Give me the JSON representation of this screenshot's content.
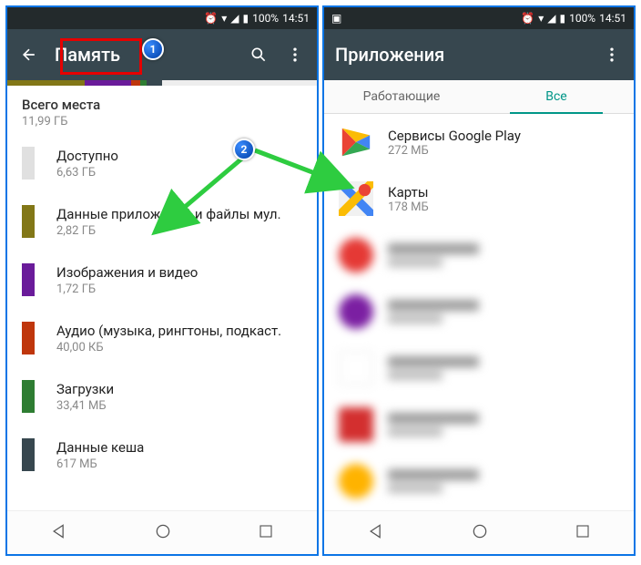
{
  "status": {
    "battery": "100%",
    "time": "14:51"
  },
  "left": {
    "title": "Память",
    "total_label": "Всего места",
    "total_value": "11,99 ГБ",
    "items": [
      {
        "label": "Доступно",
        "value": "6,63 ГБ",
        "color": "#e0e0e0"
      },
      {
        "label": "Данные приложений и файлы мул.",
        "value": "2,82 ГБ",
        "color": "#827717"
      },
      {
        "label": "Изображения и видео",
        "value": "1,72 ГБ",
        "color": "#6a1b9a"
      },
      {
        "label": "Аудио (музыка, рингтоны, подкаст.",
        "value": "40,00 КБ",
        "color": "#bf360c"
      },
      {
        "label": "Загрузки",
        "value": "33,41 МБ",
        "color": "#2e7d32"
      },
      {
        "label": "Данные кеша",
        "value": "617 МБ",
        "color": "#37474f"
      }
    ]
  },
  "right": {
    "title": "Приложения",
    "tab_running": "Работающие",
    "tab_all": "Все",
    "apps": [
      {
        "label": "Сервисы Google Play",
        "value": "272 МБ"
      },
      {
        "label": "Карты",
        "value": "178 МБ"
      }
    ]
  },
  "annotations": {
    "marker1": "1",
    "marker2": "2"
  }
}
